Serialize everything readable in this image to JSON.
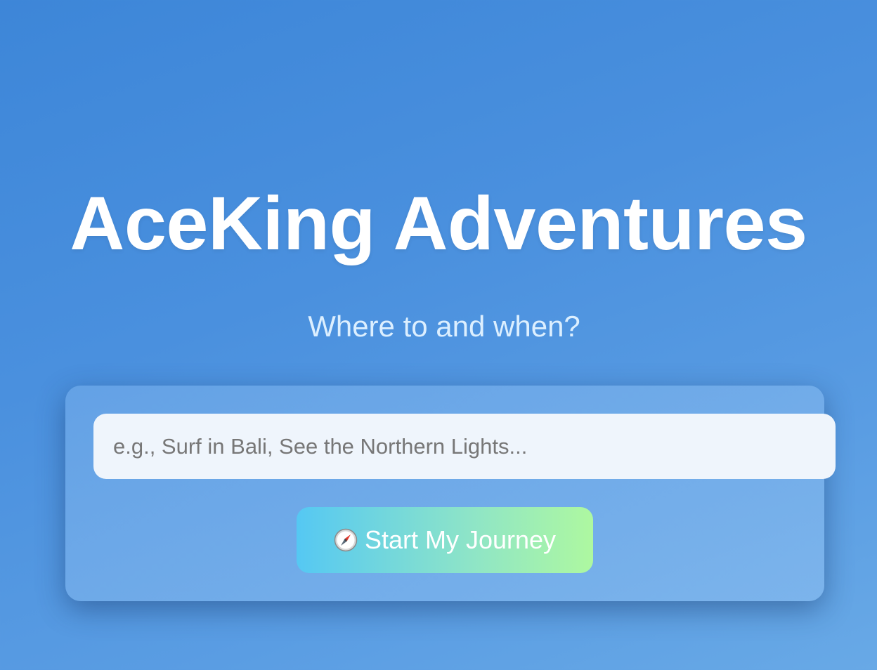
{
  "hero": {
    "title": "AceKing Adventures",
    "subtitle": "Where to and when?"
  },
  "search": {
    "value": "",
    "placeholder": "e.g., Surf in Bali, See the Northern Lights..."
  },
  "start_button": {
    "icon": "compass-icon",
    "label": "Start My Journey"
  },
  "colors": {
    "background": "#4a90de",
    "title": "#ffffff",
    "subtitle": "#dcefff",
    "button_gradient_start": "#55c8f3",
    "button_gradient_end": "#aef8a0"
  }
}
